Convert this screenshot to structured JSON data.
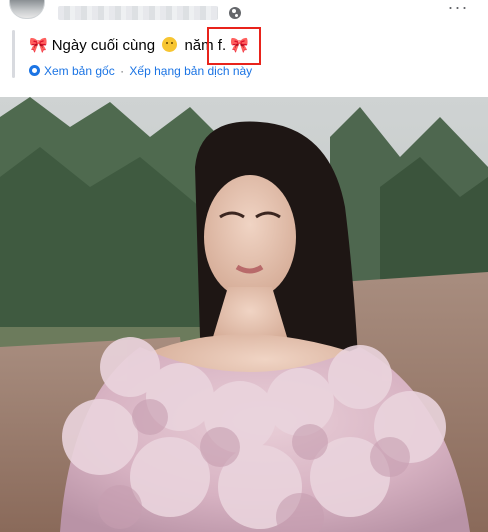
{
  "post": {
    "text": {
      "leading_emoji": "🎀",
      "part1": "Ngày cuối cùng",
      "part2": "năm",
      "part3": "f.",
      "trailing_emoji": "🎀"
    },
    "translation": {
      "see_original": "Xem bản gốc",
      "separator": "·",
      "rate_translation": "Xếp hạng bản dịch này"
    },
    "more_label": "···"
  }
}
